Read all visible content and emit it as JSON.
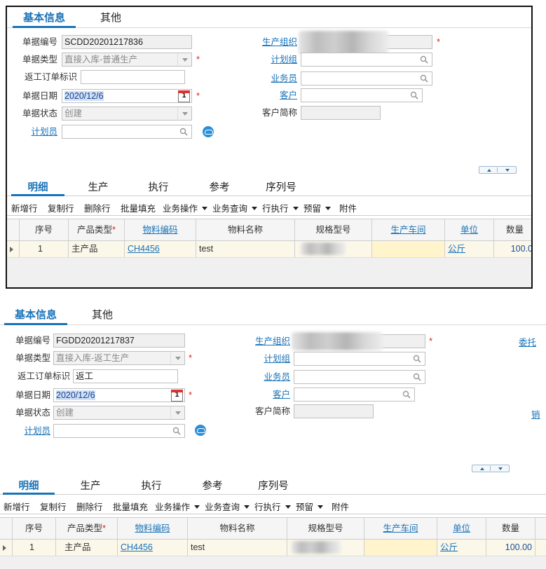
{
  "screens": [
    {
      "tabs": [
        "基本信息",
        "其他"
      ],
      "fields": {
        "doc_no_label": "单据编号",
        "doc_no": "SCDD20201217836",
        "doc_type_label": "单据类型",
        "doc_type": "直接入库-普通生产",
        "rework_label": "返工订单标识",
        "rework": "",
        "doc_date_label": "单据日期",
        "doc_date": "2020/12/6",
        "cal_day": "1",
        "doc_status_label": "单据状态",
        "doc_status": "创建",
        "planner_label": "计划员",
        "prod_org_label": "生产组织",
        "plan_group_label": "计划组",
        "salesman_label": "业务员",
        "customer_label": "客户",
        "customer_short_label": "客户简称"
      },
      "detail_tabs": [
        "明细",
        "生产",
        "执行",
        "参考",
        "序列号"
      ],
      "toolbar": [
        "新增行",
        "复制行",
        "删除行",
        "批量填充",
        "业务操作",
        "业务查询",
        "行执行",
        "预留",
        "附件"
      ],
      "columns": [
        "序号",
        "产品类型",
        "物料编码",
        "物料名称",
        "规格型号",
        "生产车间",
        "单位",
        "数量"
      ],
      "row": {
        "seq": "1",
        "product_type": "主产品",
        "material_code": "CH4456",
        "material_name": "test",
        "unit": "公斤",
        "qty": "100.0"
      },
      "required_mark": "*"
    },
    {
      "tabs": [
        "基本信息",
        "其他"
      ],
      "fields": {
        "doc_no_label": "单据编号",
        "doc_no": "FGDD20201217837",
        "doc_type_label": "单据类型",
        "doc_type": "直接入库-返工生产",
        "rework_label": "返工订单标识",
        "rework": "返工",
        "doc_date_label": "单据日期",
        "doc_date": "2020/12/6",
        "cal_day": "1",
        "doc_status_label": "单据状态",
        "doc_status": "创建",
        "planner_label": "计划员",
        "prod_org_label": "生产组织",
        "plan_group_label": "计划组",
        "salesman_label": "业务员",
        "customer_label": "客户",
        "customer_short_label": "客户简称",
        "entrust_label": "委托",
        "sales_label": "销"
      },
      "detail_tabs": [
        "明细",
        "生产",
        "执行",
        "参考",
        "序列号"
      ],
      "toolbar": [
        "新增行",
        "复制行",
        "删除行",
        "批量填充",
        "业务操作",
        "业务查询",
        "行执行",
        "预留",
        "附件"
      ],
      "columns": [
        "序号",
        "产品类型",
        "物料编码",
        "物料名称",
        "规格型号",
        "生产车间",
        "单位",
        "数量"
      ],
      "row": {
        "seq": "1",
        "product_type": "主产品",
        "material_code": "CH4456",
        "material_name": "test",
        "unit": "公斤",
        "qty": "100.00"
      },
      "required_mark": "*"
    }
  ],
  "colors": {
    "accent": "#1a73b8",
    "required": "#e02020",
    "row_bg": "#fbf7e9",
    "highlight_cell": "#fff4cc"
  },
  "icons": [
    "search-icon",
    "calendar-icon",
    "cloud-icon",
    "dropdown-arrow-icon",
    "expand-collapse-icon",
    "row-indicator-icon"
  ]
}
